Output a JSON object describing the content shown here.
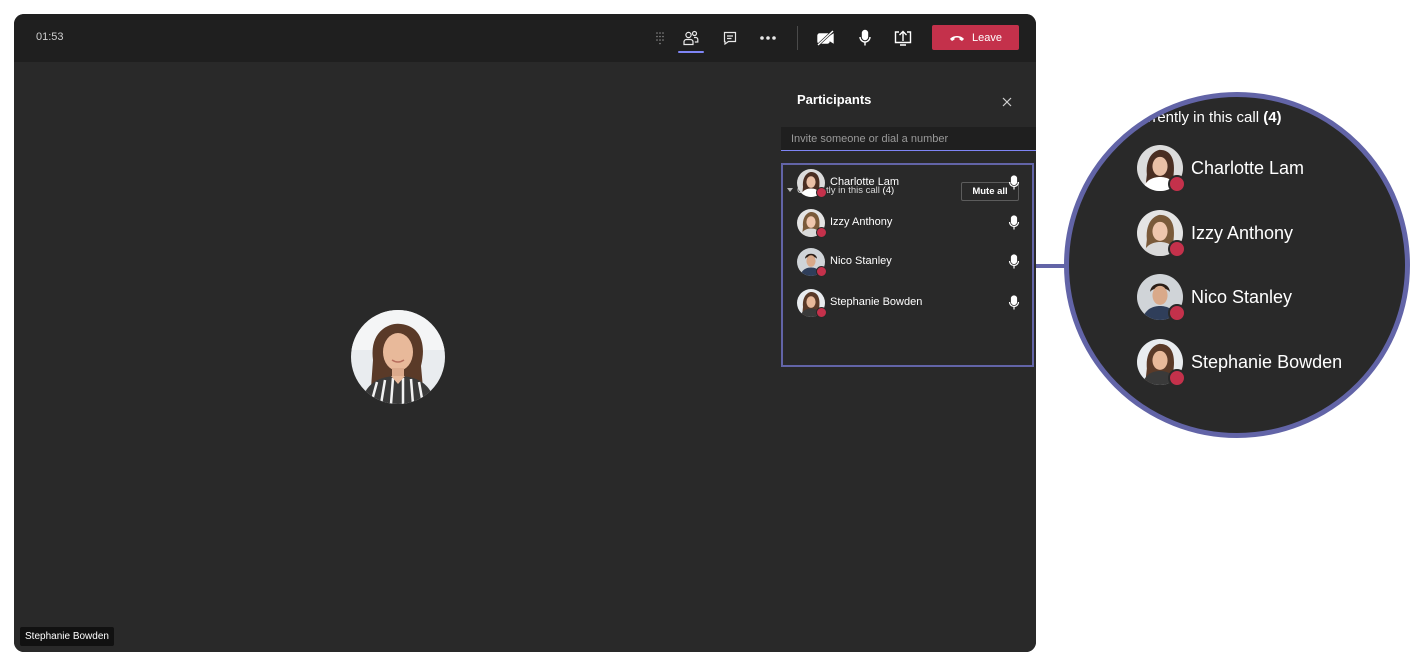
{
  "call": {
    "timer": "01:53",
    "leave_label": "Leave",
    "speaker_name": "Stephanie Bowden"
  },
  "toolbar_icons": [
    "dialpad-icon",
    "participants-icon",
    "chat-icon",
    "more-icon",
    "camera-off-icon",
    "mic-icon",
    "share-icon",
    "hangup-icon"
  ],
  "panel": {
    "title": "Participants",
    "invite_placeholder": "Invite someone or dial a number",
    "section_label": "Currently in this call",
    "section_count": "(4)",
    "mute_all_label": "Mute all",
    "participants": [
      {
        "name": "Charlotte Lam",
        "status_color": "#c4314b"
      },
      {
        "name": "Izzy Anthony",
        "status_color": "#c4314b"
      },
      {
        "name": "Nico Stanley",
        "status_color": "#c4314b"
      },
      {
        "name": "Stephanie Bowden",
        "status_color": "#c4314b"
      }
    ]
  },
  "zoom": {
    "section_label": "urrently in this call",
    "section_count": "(4)"
  },
  "colors": {
    "accent": "#6264a7",
    "leave": "#c4314b",
    "background": "#292929",
    "topbar": "#1f1f1f"
  }
}
